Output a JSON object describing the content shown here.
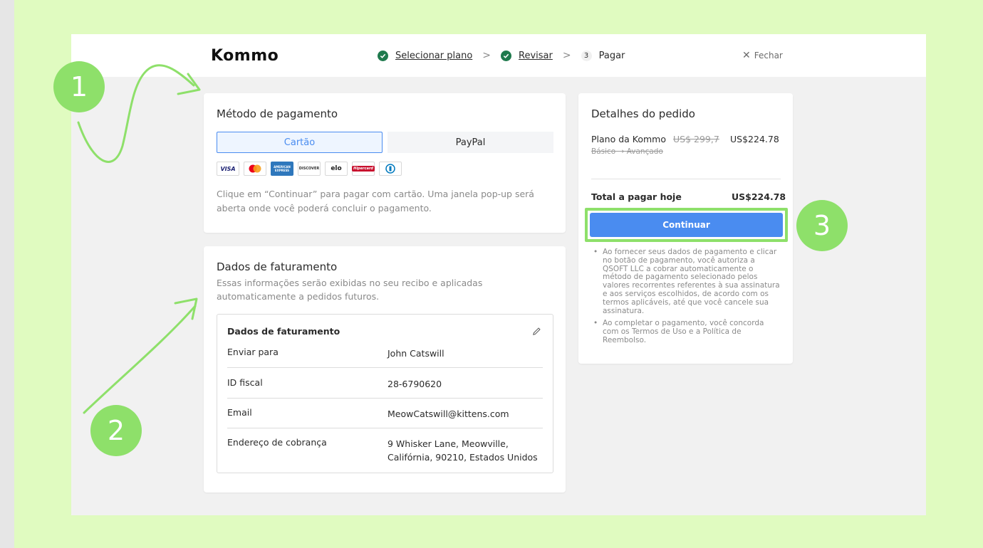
{
  "header": {
    "logo": "Kommo",
    "steps": [
      {
        "label": "Selecionar plano",
        "done": true
      },
      {
        "label": "Revisar",
        "done": true
      },
      {
        "number": "3",
        "label": "Pagar",
        "done": false
      }
    ],
    "separator": ">",
    "close_label": "Fechar",
    "close_icon": "close-icon"
  },
  "payment": {
    "title": "Método de pagamento",
    "tab_card": "Cartão",
    "tab_paypal": "PayPal",
    "brands": [
      "VISA",
      "Mastercard",
      "American Express",
      "DISCOVER",
      "elo",
      "Hipercard",
      "Diners"
    ],
    "brand_visa": "VISA",
    "brand_amex": "AMERICAN EXPRESS",
    "brand_discover": "DISCOVER",
    "brand_elo": "elo",
    "brand_hipercard": "Hipercard",
    "note": "Clique em “Continuar” para pagar com cartão. Uma janela pop-up será aberta onde você poderá concluir o pagamento."
  },
  "billing": {
    "title": "Dados de faturamento",
    "subtitle": "Essas informações serão exibidas no seu recibo e aplicadas automaticamente a pedidos futuros.",
    "box_title": "Dados de faturamento",
    "rows": [
      {
        "label": "Enviar para",
        "value": "John Catswill"
      },
      {
        "label": "ID fiscal",
        "value": "28-6790620"
      },
      {
        "label": "Email",
        "value": "MeowCatswill@kittens.com"
      },
      {
        "label": "Endereço de cobrança",
        "value": "9 Whisker Lane, Meowville, Califórnia, 90210, Estados Unidos"
      }
    ]
  },
  "order": {
    "title": "Detalhes do pedido",
    "item_name": "Plano da Kommo",
    "item_sub": "Básico → Avançado",
    "old_price": "US$ 299,7",
    "new_price": "US$224.78",
    "total_label": "Total a pagar hoje",
    "total_value": "US$224.78",
    "continue_label": "Continuar",
    "terms": [
      "Ao fornecer seus dados de pagamento e clicar no botão de pagamento, você autoriza a QSOFT LLC a cobrar automaticamente o método de pagamento selecionado pelos valores recorrentes referentes à sua assinatura e aos serviços escolhidos, de acordo com os termos aplicáveis, até que você cancele sua assinatura.",
      "Ao completar o pagamento, você concorda com os Termos de Uso e a Política de Reembolso."
    ]
  },
  "annotations": {
    "badge_1": "1",
    "badge_2": "2",
    "badge_3": "3",
    "color": "#8ee06a"
  },
  "colors": {
    "background": "#e0fbc0",
    "primary": "#4a8cf0",
    "check": "#1f7a4d"
  }
}
